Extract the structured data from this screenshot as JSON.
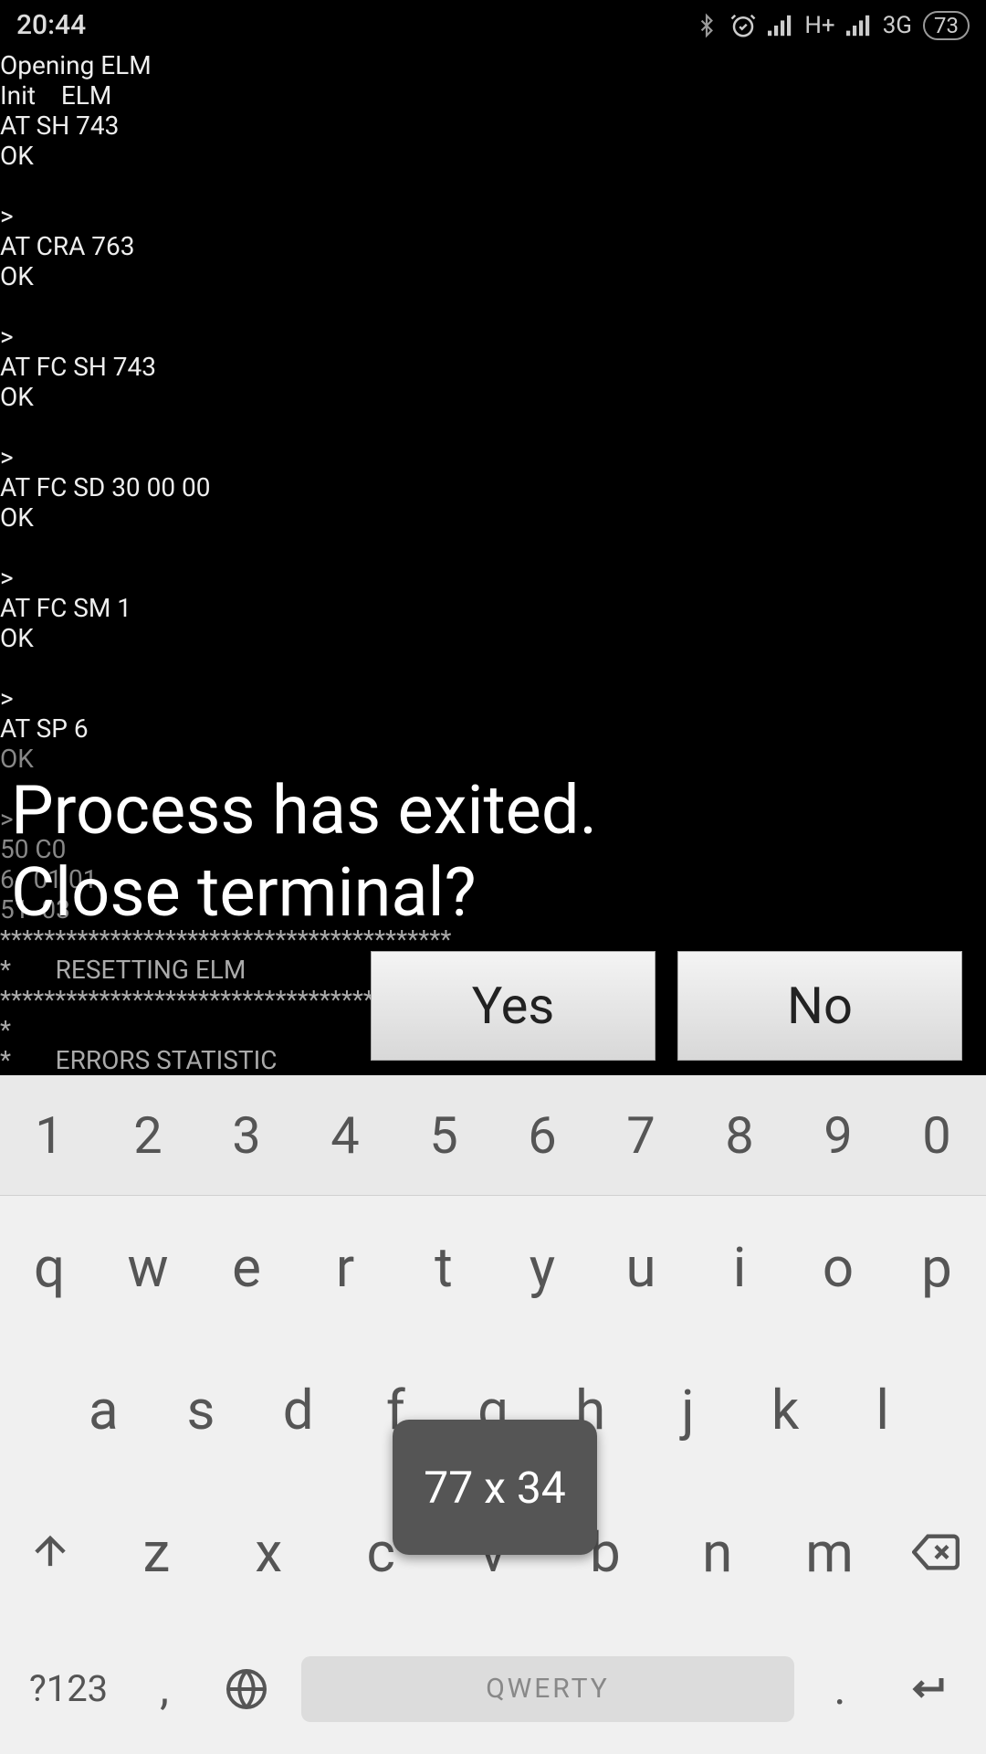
{
  "status_bar": {
    "time": "20:44",
    "signal1_label": "H+",
    "signal2_label": "3G",
    "battery": "73"
  },
  "terminal": {
    "lines": [
      "Opening ELM",
      "Init    ELM",
      "AT SH 743",
      "OK",
      "",
      ">",
      "AT CRA 763",
      "OK",
      "",
      ">",
      "AT FC SH 743",
      "OK",
      "",
      ">",
      "AT FC SD 30 00 00",
      "OK",
      "",
      ">",
      "AT FC SM 1",
      "OK",
      "",
      ">",
      "AT SP 6"
    ],
    "dim_ok": "OK",
    "dim_prompt": ">",
    "dim_l1": "50 C0",
    "dim_l2": "6   01 01",
    "dim_l3": "51  03",
    "sep": "*****************************************",
    "hdr1": "*       RESETTING ELM",
    "hdr2": "*",
    "hdr3": "*       ERRORS STATISTIC"
  },
  "dialog": {
    "line1": "Process has exited.",
    "line2": "Close terminal?",
    "yes": "Yes",
    "no": "No"
  },
  "keyboard": {
    "nums": [
      "1",
      "2",
      "3",
      "4",
      "5",
      "6",
      "7",
      "8",
      "9",
      "0"
    ],
    "row1": [
      "q",
      "w",
      "e",
      "r",
      "t",
      "y",
      "u",
      "i",
      "o",
      "p"
    ],
    "row2": [
      "a",
      "s",
      "d",
      "f",
      "g",
      "h",
      "j",
      "k",
      "l"
    ],
    "row3": [
      "z",
      "x",
      "c",
      "v",
      "b",
      "n",
      "m"
    ],
    "sym": "?123",
    "comma": ",",
    "dot": ".",
    "space_label": "QWERTY",
    "popup": "77 x 34"
  }
}
